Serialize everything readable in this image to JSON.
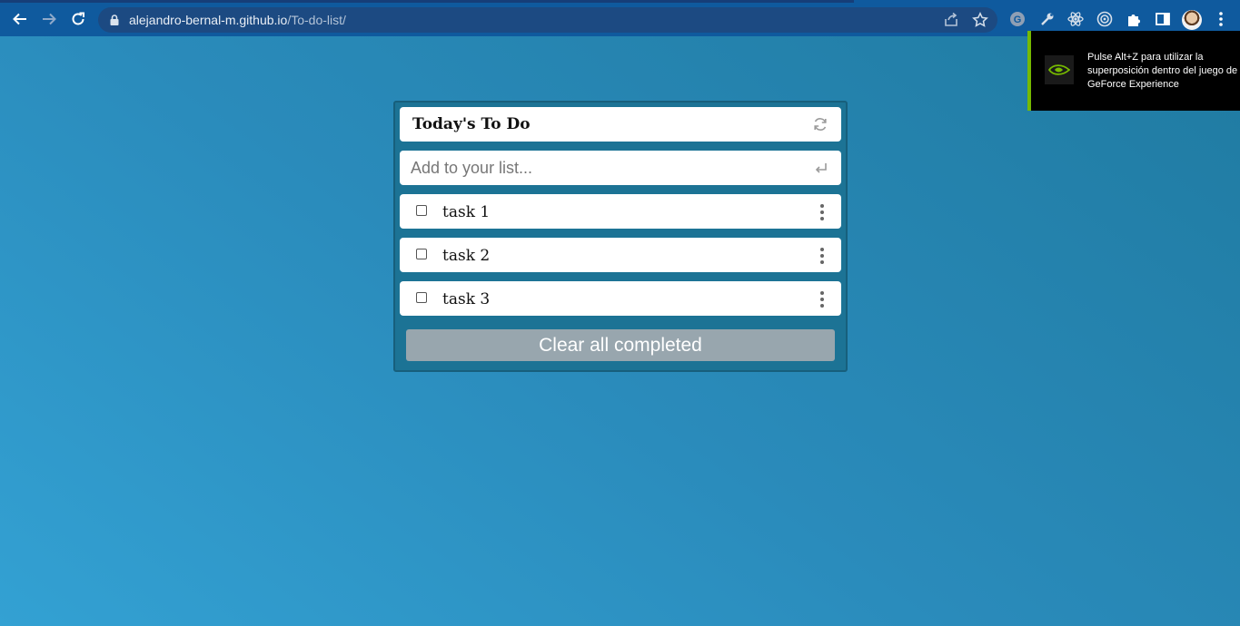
{
  "browser": {
    "url_host": "alejandro-bernal-m.github.io",
    "url_path": "/To-do-list/",
    "icons": [
      "back-arrow-icon",
      "forward-arrow-icon",
      "reload-icon",
      "lock-icon",
      "share-icon",
      "star-icon",
      "grammarly-icon",
      "wrench-icon",
      "react-icon",
      "target-icon",
      "puzzle-icon",
      "side-panel-icon",
      "avatar",
      "kebab-menu-icon"
    ]
  },
  "overlay": {
    "text": "Pulse Alt+Z para utilizar la superposición dentro del juego de GeForce Experience",
    "accent": "#76b900"
  },
  "todo": {
    "title": "Today's To Do",
    "input_placeholder": "Add to your list...",
    "tasks": [
      {
        "label": "task 1",
        "completed": false
      },
      {
        "label": "task 2",
        "completed": false
      },
      {
        "label": "task 3",
        "completed": false
      }
    ],
    "clear_label": "Clear all completed"
  },
  "colors": {
    "browser_bar": "#0f5a9e",
    "app_background": "#1c7395",
    "clear_button": "#98a6ae"
  }
}
